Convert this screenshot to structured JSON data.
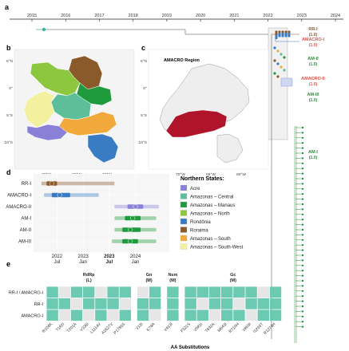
{
  "panels": {
    "a": "a",
    "b": "b",
    "c": "c",
    "d": "d",
    "e": "e"
  },
  "timeline": {
    "years": [
      "2015",
      "2016",
      "2017",
      "2018",
      "2019",
      "2020",
      "2021",
      "2022",
      "2023",
      "2024"
    ]
  },
  "tree_clades": [
    {
      "name": "RR-I",
      "support": "(1.0)",
      "color": "#8b5a2b"
    },
    {
      "name": "AMACRO-I",
      "support": "(1.0)",
      "color": "#e0524a"
    },
    {
      "name": "AM-II",
      "support": "(1.0)",
      "color": "#2e8b3a"
    },
    {
      "name": "AMACRO-II",
      "support": "(1.0)",
      "color": "#e0524a"
    },
    {
      "name": "AM-III",
      "support": "(1.0)",
      "color": "#2e8b3a"
    },
    {
      "name": "AM-I",
      "support": "(1.0)",
      "color": "#2e8b3a"
    }
  ],
  "map_b": {
    "lat_labels": [
      "5°N",
      "0°",
      "5°S",
      "10°S"
    ],
    "lon_labels": [
      "70°W",
      "65°W",
      "60°W"
    ]
  },
  "map_c": {
    "title": "AMACRO Region",
    "lat_labels": [
      "5°N",
      "0°",
      "5°S",
      "10°S"
    ],
    "lon_labels": [
      "70°W",
      "65°W",
      "60°W"
    ]
  },
  "legend": {
    "title": "Northern States:",
    "items": [
      {
        "label": "Acre",
        "color": "#8a80d8"
      },
      {
        "label": "Amazonas – Central",
        "color": "#5cbf9a"
      },
      {
        "label": "Amazonas – Manaus",
        "color": "#1f9a3c"
      },
      {
        "label": "Amazonas – North",
        "color": "#8cc73f"
      },
      {
        "label": "Rondônia",
        "color": "#3a7cc4"
      },
      {
        "label": "Roraima",
        "color": "#8b5a2b"
      },
      {
        "label": "Amazonas – South",
        "color": "#f2a93b"
      },
      {
        "label": "Amazonas – South-West",
        "color": "#f3f0a0"
      }
    ]
  },
  "chart_data": [
    {
      "type": "range",
      "rows": [
        "RR-I",
        "AMACRO-I",
        "AMACRO-II",
        "AM-I",
        "AM-II",
        "AM-III"
      ],
      "x_ticks": [
        "2022\nJul",
        "2023\nJan",
        "2023\nJul",
        "2024\nJan"
      ],
      "ranges": [
        {
          "row": "RR-I",
          "outer": [
            2021.65,
            2023.05
          ],
          "inner": [
            2021.75,
            2021.95
          ],
          "point": 2021.85,
          "color": "#8b5a2b"
        },
        {
          "row": "AMACRO-I",
          "outer": [
            2021.7,
            2022.75
          ],
          "inner": [
            2021.85,
            2022.2
          ],
          "point": 2022.0,
          "color": "#3a7cc4"
        },
        {
          "row": "AMACRO-II",
          "outer": [
            2023.05,
            2023.9
          ],
          "inner": [
            2023.3,
            2023.6
          ],
          "point": 2023.45,
          "color": "#8a80d8"
        },
        {
          "row": "AM-I",
          "outer": [
            2023.05,
            2023.85
          ],
          "inner": [
            2023.25,
            2023.55
          ],
          "point": 2023.4,
          "color": "#1f9a3c"
        },
        {
          "row": "AM-II",
          "outer": [
            2023.05,
            2023.85
          ],
          "inner": [
            2023.2,
            2023.55
          ],
          "point": 2023.35,
          "color": "#1f9a3c"
        },
        {
          "row": "AM-III",
          "outer": [
            2023.0,
            2023.85
          ],
          "inner": [
            2023.2,
            2023.5
          ],
          "point": 2023.35,
          "color": "#1f9a3c"
        }
      ]
    },
    {
      "type": "heatmap",
      "rows": [
        "RR-I / AMACRO-I",
        "RR-I",
        "AMACRO-I"
      ],
      "groups": [
        {
          "title": "RdRp",
          "subtitle": "(L)",
          "columns": [
            "R104K",
            "T182I",
            "T201A",
            "V336I",
            "L1114V",
            "A1627V",
            "P1785S"
          ]
        },
        {
          "title": "Gn",
          "subtitle": "(M)",
          "columns": [
            "V13I",
            "K74R"
          ]
        },
        {
          "title": "Nsm",
          "subtitle": "(M)",
          "columns": [
            "V413I"
          ]
        },
        {
          "title": "Gc",
          "subtitle": "(M)",
          "columns": [
            "F521S",
            "V581I",
            "T632A",
            "M643I",
            "R710H",
            "V803I",
            "I1203T",
            "R1274H"
          ]
        }
      ],
      "values": [
        [
          1,
          0,
          1,
          1,
          0,
          1,
          1,
          0,
          1,
          1,
          1,
          1,
          1,
          1,
          1,
          1,
          0,
          1
        ],
        [
          1,
          1,
          0,
          1,
          1,
          1,
          0,
          1,
          1,
          1,
          1,
          0,
          1,
          1,
          0,
          1,
          1,
          1
        ],
        [
          1,
          0,
          1,
          0,
          1,
          0,
          1,
          1,
          0,
          1,
          1,
          1,
          0,
          1,
          1,
          0,
          1,
          1
        ]
      ],
      "xlabel": "AA Substitutions",
      "on_color": "#6cc9b2",
      "off_color": "#e6e6e6"
    }
  ]
}
